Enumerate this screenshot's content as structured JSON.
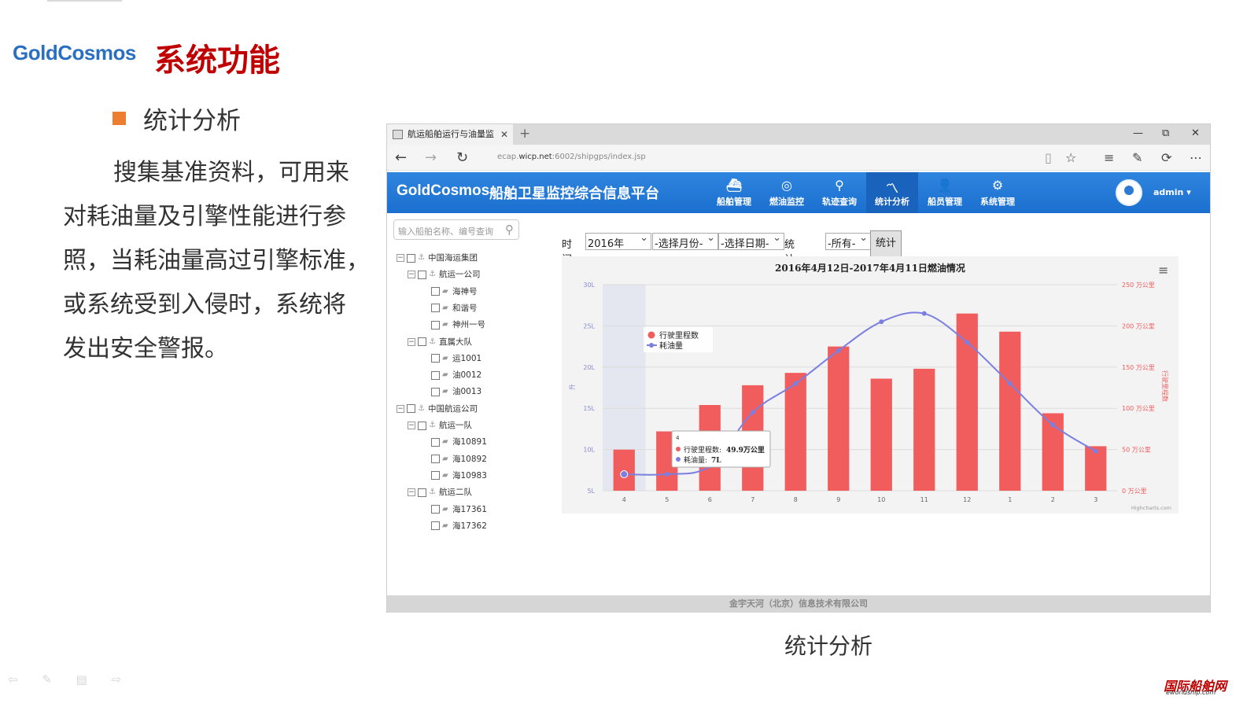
{
  "slide": {
    "logo": "GoldCosmos",
    "title": "系统功能",
    "bullet": "统计分析",
    "paragraph_lines": [
      "搜集基准资料，可用来",
      "对耗油量及引擎性能进行参",
      "照，当耗油量高过引擎标准，",
      "或系统受到入侵时，系统将",
      "发出安全警报。"
    ],
    "caption": "统计分析",
    "nav_controls": "⇦ ✎ ▤ ⇨",
    "watermark": "国际船舶网",
    "watermark_sub": "eworldship.com"
  },
  "browser": {
    "tab_title": "航运船舶运行与油量监",
    "tab_close": "✕",
    "new_tab": "+",
    "url_prefix": "ecap.",
    "url_host": "wicp.net",
    "url_path": ":6002/shipgps/index.jsp",
    "window_buttons": [
      "—",
      "⧉",
      "✕"
    ]
  },
  "app": {
    "logo": "GoldCosmos",
    "title": "船舶卫星监控综合信息平台",
    "nav": [
      {
        "label": "船舶管理",
        "icon": "ship-icon"
      },
      {
        "label": "燃油监控",
        "icon": "fuel-monitor-icon"
      },
      {
        "label": "轨迹查询",
        "icon": "track-icon"
      },
      {
        "label": "统计分析",
        "icon": "chart-icon",
        "active": true
      },
      {
        "label": "船员管理",
        "icon": "crew-icon"
      },
      {
        "label": "系统管理",
        "icon": "settings-icon"
      }
    ],
    "user": "admin ▾",
    "search_placeholder": "输入船舶名称、编号查询",
    "footer": "金宇天河（北京）信息技术有限公司"
  },
  "tree": [
    {
      "label": "中国海运集团",
      "level": 0,
      "type": "group"
    },
    {
      "label": "航运一公司",
      "level": 1,
      "type": "group"
    },
    {
      "label": "海神号",
      "level": 2,
      "type": "ship"
    },
    {
      "label": "和谐号",
      "level": 2,
      "type": "ship"
    },
    {
      "label": "神州一号",
      "level": 2,
      "type": "ship"
    },
    {
      "label": "直属大队",
      "level": 1,
      "type": "group"
    },
    {
      "label": "运1001",
      "level": 2,
      "type": "ship"
    },
    {
      "label": "油0012",
      "level": 2,
      "type": "ship"
    },
    {
      "label": "油0013",
      "level": 2,
      "type": "ship"
    },
    {
      "label": "中国航运公司",
      "level": 0,
      "type": "group"
    },
    {
      "label": "航运一队",
      "level": 1,
      "type": "group"
    },
    {
      "label": "海10891",
      "level": 2,
      "type": "ship"
    },
    {
      "label": "海10892",
      "level": 2,
      "type": "ship"
    },
    {
      "label": "海10983",
      "level": 2,
      "type": "ship"
    },
    {
      "label": "航运二队",
      "level": 1,
      "type": "group"
    },
    {
      "label": "海17361",
      "level": 2,
      "type": "ship"
    },
    {
      "label": "海17362",
      "level": 2,
      "type": "ship"
    }
  ],
  "filters": {
    "time_label": "时间:",
    "year": "2016年",
    "month": "-选择月份-",
    "day": "-选择日期-",
    "data_label": "统计数据",
    "data_value": "-所有-",
    "button": "统计"
  },
  "chart_data": {
    "type": "bar+line",
    "title": "2016年4月12日-2017年4月11日燃油情况",
    "categories": [
      "4",
      "5",
      "6",
      "7",
      "8",
      "9",
      "10",
      "11",
      "12",
      "1",
      "2",
      "3"
    ],
    "series": [
      {
        "name": "行驶里程数",
        "type": "bar",
        "axis": "right",
        "color": "#f15c5c",
        "values": [
          49.9,
          72,
          104,
          128,
          143,
          175,
          136,
          148,
          215,
          193,
          94,
          54
        ]
      },
      {
        "name": "耗油量",
        "type": "line",
        "axis": "left",
        "color": "#7b7fe0",
        "values": [
          7,
          7,
          8,
          14.5,
          18,
          22,
          25.5,
          26.5,
          23,
          18,
          13,
          9.8
        ]
      }
    ],
    "left_axis": {
      "label": "升",
      "ticks": [
        "5L",
        "10L",
        "15L",
        "20L",
        "25L",
        "30L"
      ],
      "range": [
        5,
        30
      ]
    },
    "right_axis": {
      "label": "行驶里程数",
      "ticks": [
        "0 万公里",
        "50 万公里",
        "100 万公里",
        "150 万公里",
        "200 万公里",
        "250 万公里"
      ],
      "range": [
        0,
        250
      ]
    },
    "legend_position": "top-left",
    "highlight_category": "4",
    "tooltip": {
      "header": "4",
      "line1_label": "行驶里程数:",
      "line1_value": "49.9万公里",
      "line2_label": "耗油量:",
      "line2_value": "7L"
    },
    "credit": "Highcharts.com"
  }
}
